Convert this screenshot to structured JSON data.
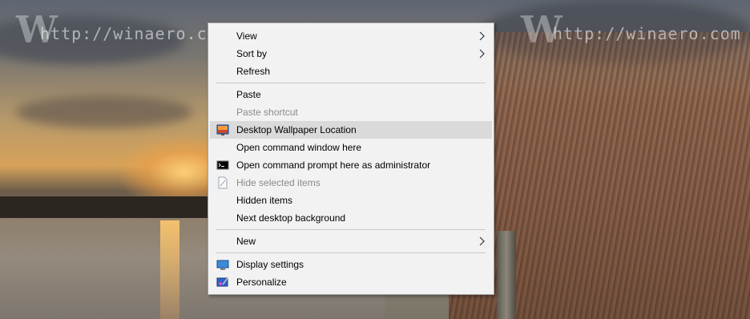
{
  "watermark": {
    "text": "http://winaero.com",
    "logo": "W"
  },
  "menu": {
    "items": [
      {
        "label": "View",
        "submenu": true
      },
      {
        "label": "Sort by",
        "submenu": true
      },
      {
        "label": "Refresh"
      },
      {
        "label": "Paste"
      },
      {
        "label": "Paste shortcut",
        "disabled": true
      },
      {
        "label": "Desktop Wallpaper Location",
        "highlighted": true,
        "icon": "wallpaper-icon"
      },
      {
        "label": "Open command window here"
      },
      {
        "label": "Open command prompt here as administrator",
        "icon": "cmd-icon"
      },
      {
        "label": "Hide selected items",
        "disabled": true,
        "icon": "page-icon"
      },
      {
        "label": "Hidden items"
      },
      {
        "label": "Next desktop background"
      },
      {
        "label": "New",
        "submenu": true
      },
      {
        "label": "Display settings",
        "icon": "monitor-icon"
      },
      {
        "label": "Personalize",
        "icon": "personalize-icon"
      }
    ]
  },
  "colors": {
    "menu_bg": "#f2f2f2",
    "highlight": "#dadada",
    "disabled_text": "#8a8a8a"
  }
}
